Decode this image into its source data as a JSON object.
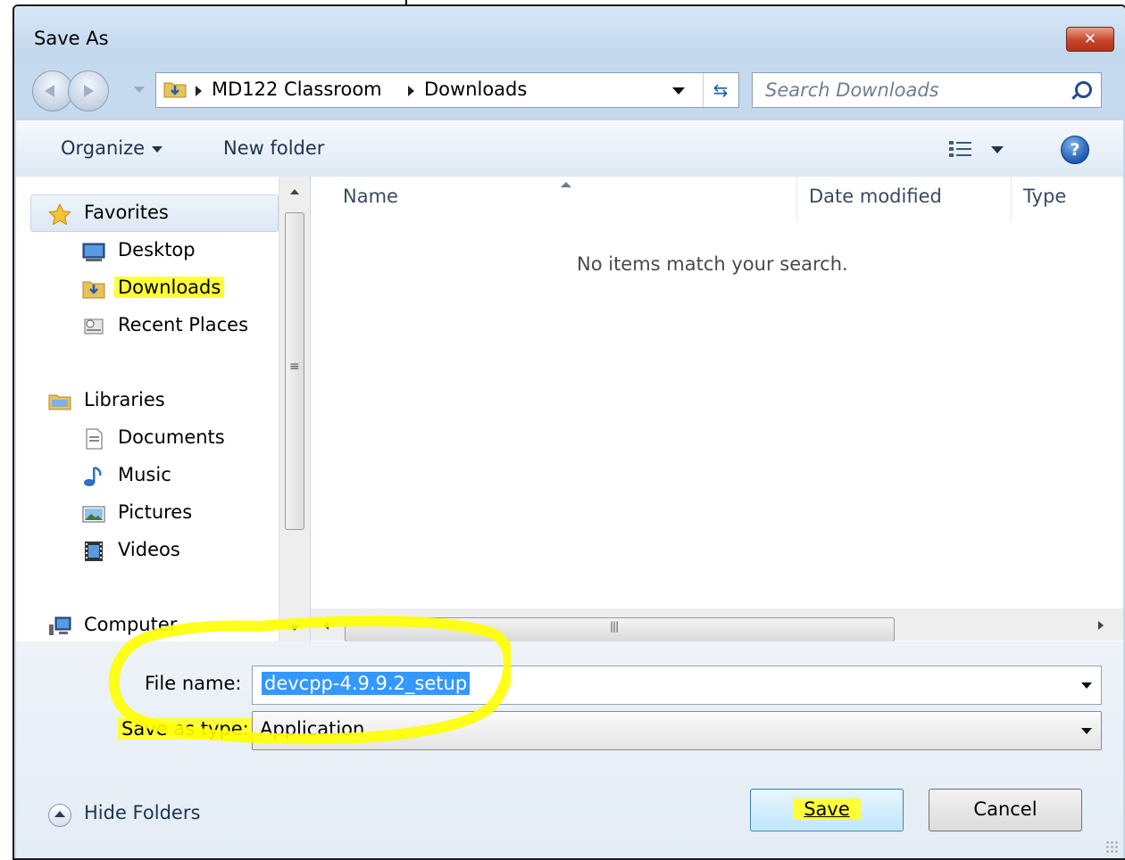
{
  "window": {
    "title": "Save As",
    "close_glyph": "✕"
  },
  "address_bar": {
    "breadcrumbs": [
      "MD122 Classroom",
      "Downloads"
    ],
    "refresh_icon": "refresh-icon",
    "search_placeholder": "Search Downloads"
  },
  "toolbar": {
    "organize": "Organize",
    "new_folder": "New folder",
    "help": "?"
  },
  "nav_pane": {
    "favorites": {
      "label": "Favorites",
      "items": [
        "Desktop",
        "Downloads",
        "Recent Places"
      ]
    },
    "libraries": {
      "label": "Libraries",
      "items": [
        "Documents",
        "Music",
        "Pictures",
        "Videos"
      ]
    },
    "computer": "Computer",
    "highlighted_item": "Downloads"
  },
  "file_list": {
    "columns": [
      "Name",
      "Date modified",
      "Type"
    ],
    "empty_message": "No items match your search."
  },
  "form": {
    "file_name_label": "File name:",
    "file_name_value": "devcpp-4.9.9.2_setup",
    "save_as_type_label": "Save as type:",
    "save_as_type_value": "Application"
  },
  "footer": {
    "hide_folders": "Hide Folders",
    "save_button": "Save",
    "cancel_button": "Cancel"
  },
  "colors": {
    "highlighter": "#ffff38",
    "selection": "#3399ff",
    "frame": "#c3d8ee"
  }
}
